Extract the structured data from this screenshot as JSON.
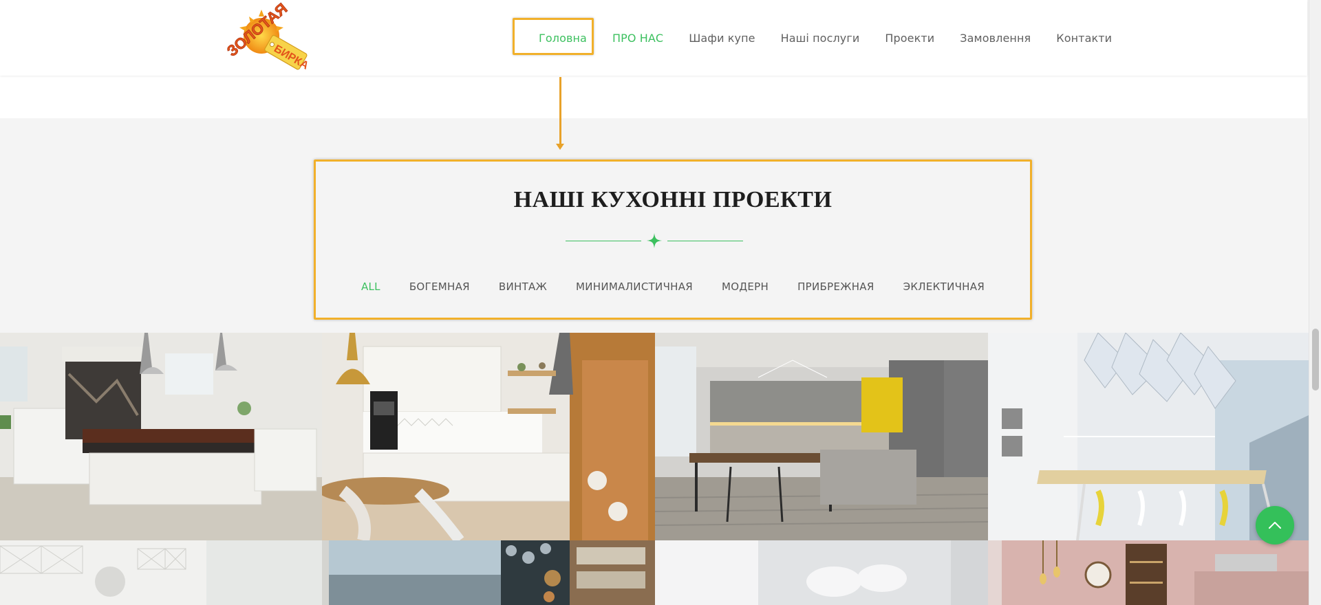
{
  "logo": {
    "text_line1": "ЗОЛОТАЯ",
    "text_line2": "БИРКА"
  },
  "nav": {
    "items": [
      {
        "label": "Головна",
        "active": true
      },
      {
        "label": "ПРО НАС",
        "active": true
      },
      {
        "label": "Шафи купе",
        "active": false
      },
      {
        "label": "Наші послуги",
        "active": false
      },
      {
        "label": "Проекти",
        "active": false
      },
      {
        "label": "Замовлення",
        "active": false
      },
      {
        "label": "Контакти",
        "active": false
      }
    ]
  },
  "section": {
    "title": "НАШІ КУХОННІ ПРОЕКТИ"
  },
  "filters": [
    {
      "label": "ALL",
      "active": true
    },
    {
      "label": "БОГЕМНАЯ",
      "active": false
    },
    {
      "label": "ВИНТАЖ",
      "active": false
    },
    {
      "label": "МИНИМАЛИСТИЧНАЯ",
      "active": false
    },
    {
      "label": "МОДЕРН",
      "active": false
    },
    {
      "label": "ПРИБРЕЖНАЯ",
      "active": false
    },
    {
      "label": "ЭКЛЕКТИЧНАЯ",
      "active": false
    }
  ],
  "colors": {
    "accent_green": "#3cc05f",
    "highlight_orange": "#f1b02a",
    "title_dark": "#1e1e1e",
    "nav_gray": "#606060"
  },
  "icons": {
    "divider": "four-point-star-icon",
    "back_to_top": "chevron-up-icon"
  }
}
